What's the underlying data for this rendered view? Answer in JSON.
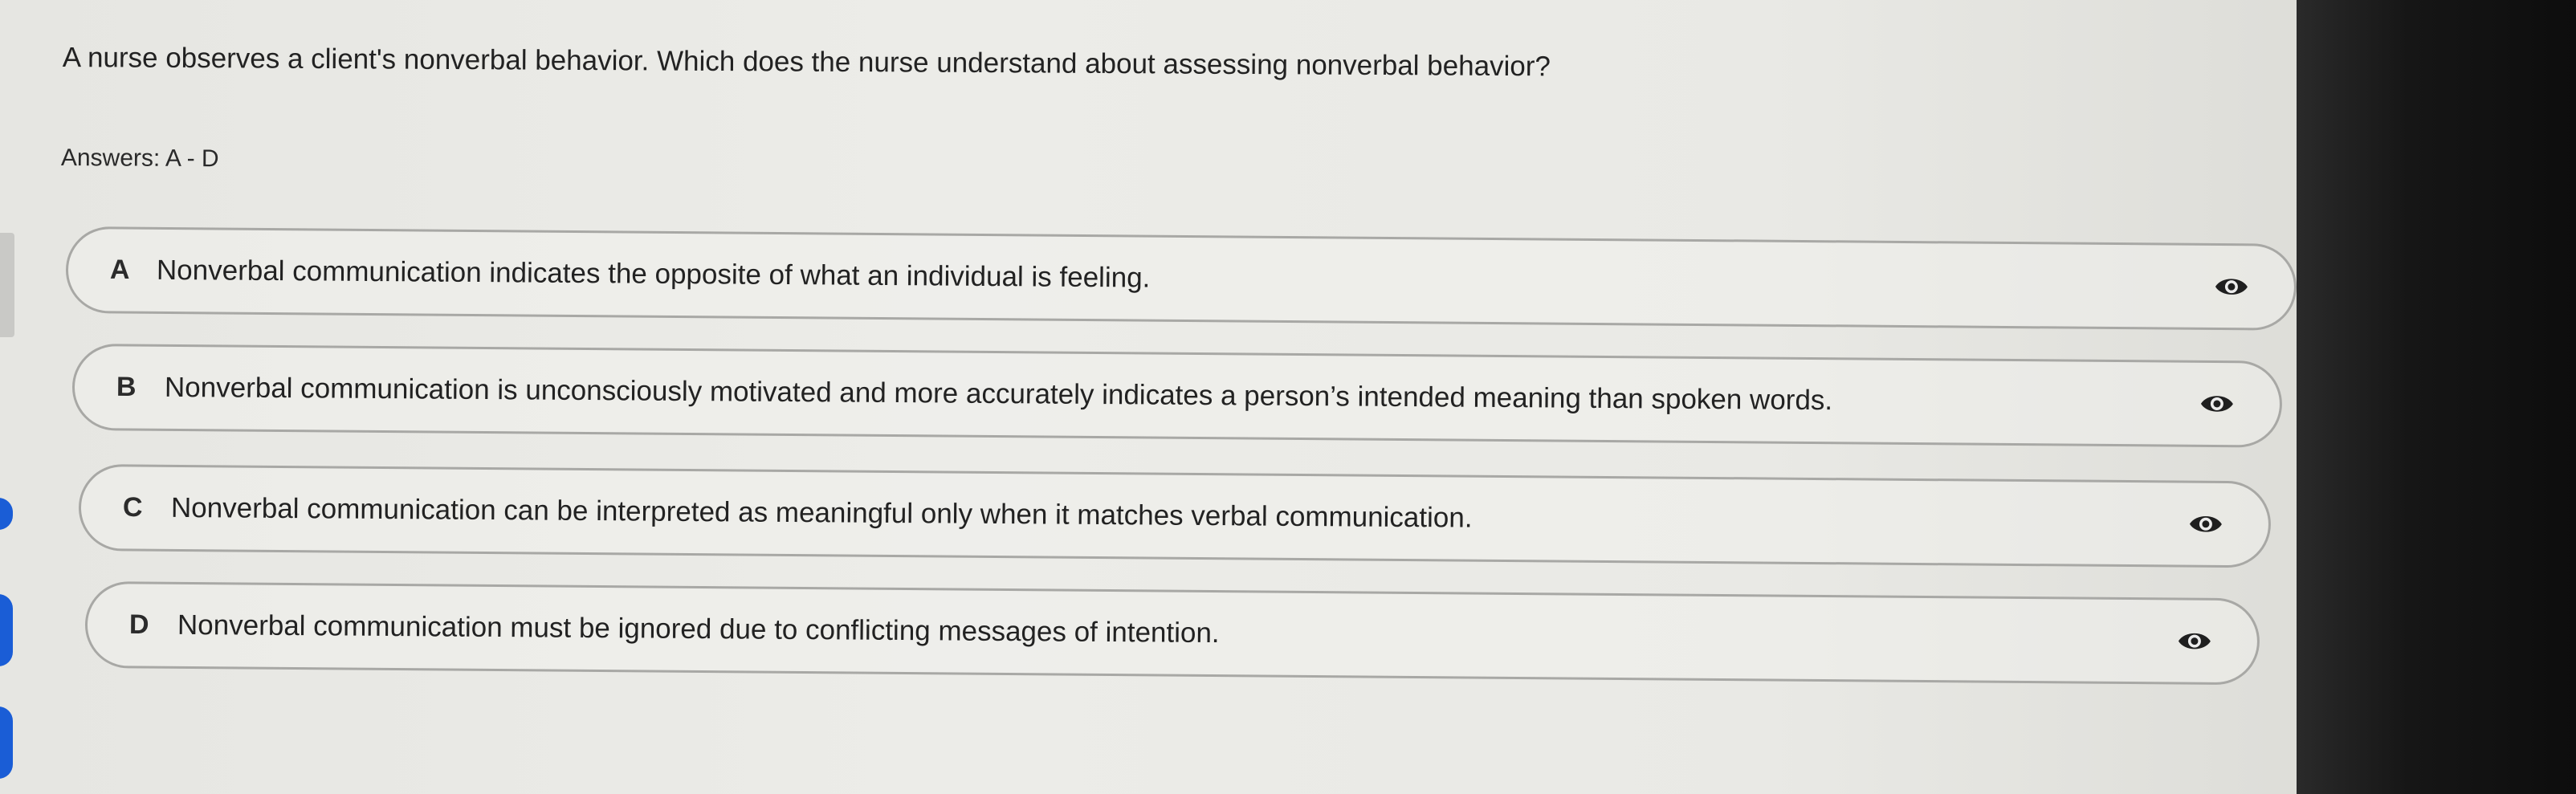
{
  "question": {
    "text": "A nurse observes a client's nonverbal behavior. Which does the nurse understand about assessing nonverbal behavior?"
  },
  "answers_label": "Answers: A - D",
  "options": [
    {
      "letter": "A",
      "text": "Nonverbal communication indicates the opposite of what an individual is feeling.",
      "icon": "eye-icon"
    },
    {
      "letter": "B",
      "text": "Nonverbal communication is unconsciously motivated and more accurately indicates a person’s intended meaning than spoken words.",
      "icon": "eye-icon"
    },
    {
      "letter": "C",
      "text": "Nonverbal communication can be interpreted as meaningful only when it matches verbal communication.",
      "icon": "eye-icon"
    },
    {
      "letter": "D",
      "text": "Nonverbal communication must be ignored due to conflicting messages of intention.",
      "icon": "eye-icon"
    }
  ],
  "colors": {
    "background": "#e9e9e5",
    "border": "#a8a8a5",
    "text": "#222222",
    "accent": "#1a5dd6"
  }
}
